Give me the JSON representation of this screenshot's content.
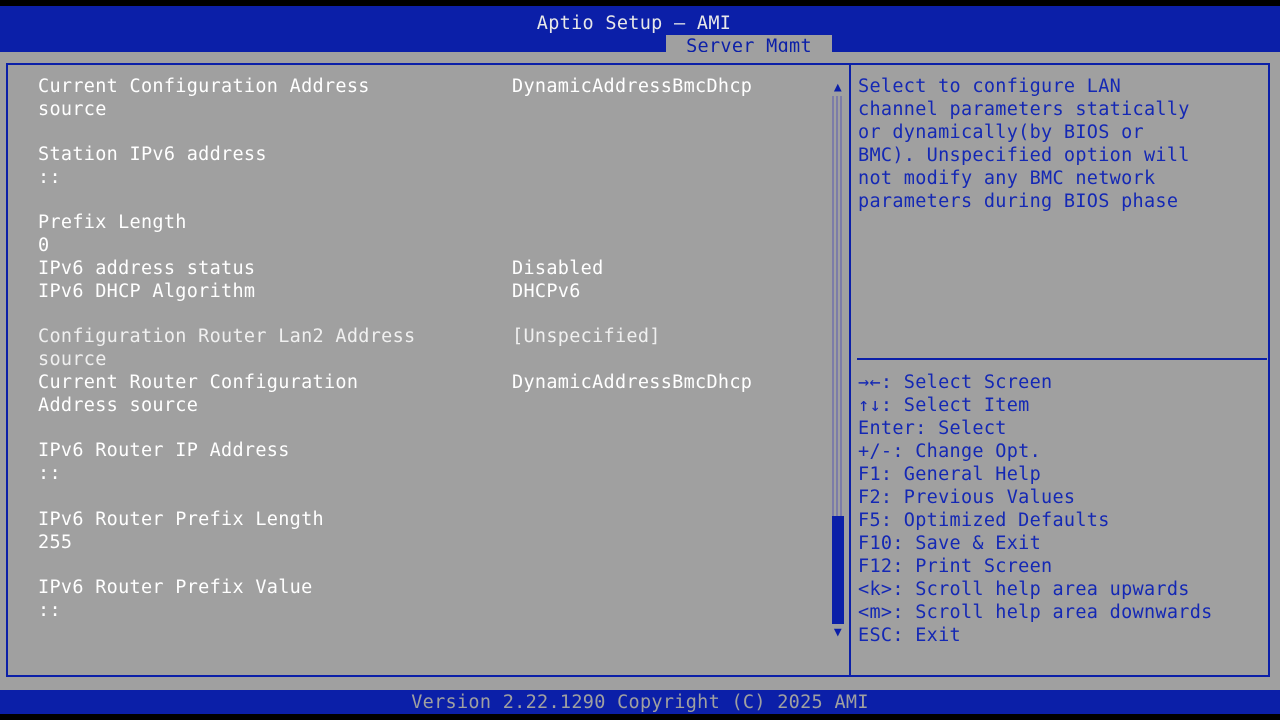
{
  "header": {
    "title": "Aptio Setup – AMI",
    "active_tab": "Server Mgmt"
  },
  "settings": {
    "current_config_address_source": {
      "label_line1": "Current Configuration Address",
      "label_line2": "source",
      "value": "DynamicAddressBmcDhcp"
    },
    "station_ipv6_address": {
      "label": "Station IPv6 address",
      "value": "::"
    },
    "prefix_length": {
      "label": "Prefix Length",
      "value": "0"
    },
    "ipv6_address_status": {
      "label": "IPv6 address status",
      "value": "Disabled"
    },
    "ipv6_dhcp_algorithm": {
      "label": "IPv6 DHCP Algorithm",
      "value": "DHCPv6"
    },
    "config_router_lan2_address_source": {
      "label_line1": "Configuration Router Lan2 Address",
      "label_line2": "source",
      "value": "[Unspecified]"
    },
    "current_router_config_address_source": {
      "label_line1": "Current Router Configuration",
      "label_line2": "Address source",
      "value": "DynamicAddressBmcDhcp"
    },
    "ipv6_router_ip_address": {
      "label": "IPv6 Router IP Address",
      "value": "::"
    },
    "ipv6_router_prefix_length": {
      "label": "IPv6 Router Prefix Length",
      "value": "255"
    },
    "ipv6_router_prefix_value": {
      "label": "IPv6 Router Prefix Value",
      "value": "::"
    }
  },
  "help": {
    "lines": [
      "Select to configure LAN",
      "channel parameters statically",
      "or dynamically(by BIOS or",
      "BMC). Unspecified option will",
      "not modify any BMC network",
      "parameters during BIOS phase"
    ]
  },
  "keys": [
    "→←: Select Screen",
    "↑↓: Select Item",
    "Enter: Select",
    "+/-: Change Opt.",
    "F1: General Help",
    "F2: Previous Values",
    "F5: Optimized Defaults",
    "F10: Save & Exit",
    "F12: Print Screen",
    "<k>: Scroll help area upwards",
    "<m>: Scroll help area downwards",
    "ESC: Exit"
  ],
  "scrollbar": {
    "up_arrow": "▲",
    "down_arrow": "▼",
    "thumb_start_fraction": 0.795,
    "thumb_end_fraction": 1.0
  },
  "footer": {
    "version_text": "Version 2.22.1290 Copyright (C) 2025 AMI"
  },
  "colors": {
    "bios_blue": "#0b1fa8",
    "bios_gray": "#a0a0a0",
    "text_white": "#ffffff",
    "help_text_blue": "#1428b4"
  }
}
